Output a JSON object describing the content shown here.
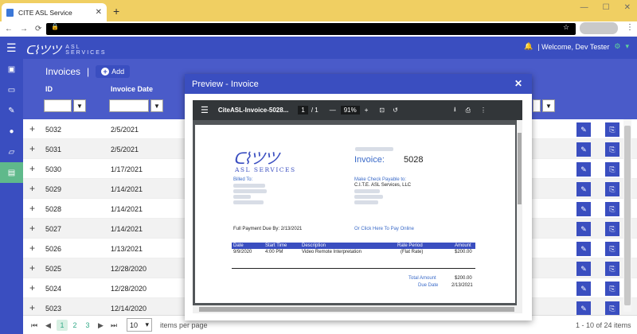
{
  "browser": {
    "tab_title": "CITE ASL Service"
  },
  "header": {
    "logo_text": "ASL",
    "logo_sub": "SERVICES",
    "welcome": "| Welcome, Dev Tester"
  },
  "grid": {
    "title": "Invoices",
    "add_label": "Add",
    "col_id": "ID",
    "col_date": "Invoice Date",
    "rows": [
      {
        "id": "5032",
        "date": "2/5/2021"
      },
      {
        "id": "5031",
        "date": "2/5/2021"
      },
      {
        "id": "5030",
        "date": "1/17/2021"
      },
      {
        "id": "5029",
        "date": "1/14/2021"
      },
      {
        "id": "5028",
        "date": "1/14/2021"
      },
      {
        "id": "5027",
        "date": "1/14/2021"
      },
      {
        "id": "5026",
        "date": "1/13/2021"
      },
      {
        "id": "5025",
        "date": "12/28/2020"
      },
      {
        "id": "5024",
        "date": "12/28/2020"
      },
      {
        "id": "5023",
        "date": "12/14/2020"
      }
    ]
  },
  "pager": {
    "pages": [
      "1",
      "2",
      "3"
    ],
    "page_size": "10",
    "items_per_page": "items per page",
    "summary": "1 - 10 of 24 items"
  },
  "modal": {
    "title": "Preview - Invoice",
    "pdf_filename": "CiteASL-Invoice-5028...",
    "page_current": "1",
    "page_total": "/ 1",
    "zoom": "91%"
  },
  "invoice": {
    "logo_text": "ASL SERVICES",
    "invoice_label": "Invoice:",
    "invoice_number": "5028",
    "billed_to": "Billed To:",
    "payable": "Make Check Payable to:",
    "payable_name": "C.I.T.E. ASL Services, LLC",
    "due_line": "Full Payment Due By: 2/13/2021",
    "pay_online": "Or Click Here To Pay Online",
    "table_headers": [
      "Date",
      "Start Time",
      "Description",
      "Rate Period",
      "Amount"
    ],
    "line": {
      "date": "9/9/2020",
      "start": "4:00 PM",
      "desc": "Video Remote Interpretation",
      "rate": "(Flat Rate)",
      "amount": "$200.00"
    },
    "total_label": "Total Amount",
    "total_value": "$200.00",
    "due_label": "Due Date",
    "due_value": "2/13/2021"
  }
}
